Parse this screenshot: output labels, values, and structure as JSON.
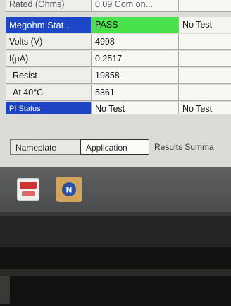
{
  "header_partial": {
    "c0": "Rated (Ohms)",
    "c1": "0.09 Com on...",
    "c2": ""
  },
  "rows": [
    {
      "label": "Megohm Stat...",
      "value": "PASS",
      "extra": "No Test"
    },
    {
      "label": "Volts (V) —",
      "value": "4998",
      "extra": ""
    },
    {
      "label": "I(µA)",
      "value": "0.2517",
      "extra": ""
    },
    {
      "label": "Resist",
      "value": "19858",
      "extra": ""
    },
    {
      "label": "At 40°C",
      "value": "5361",
      "extra": ""
    },
    {
      "label": "PI Status",
      "value": "No Test",
      "extra": "No Test"
    }
  ],
  "tabs": [
    "Nameplate",
    "Application",
    "Results Summa"
  ],
  "taskbar": {
    "icons": [
      "app-icon-red",
      "app-icon-n"
    ],
    "n_letter": "N"
  },
  "colors": {
    "status_label_bg": "#1b46c8",
    "pass_bg": "#49e24d"
  }
}
